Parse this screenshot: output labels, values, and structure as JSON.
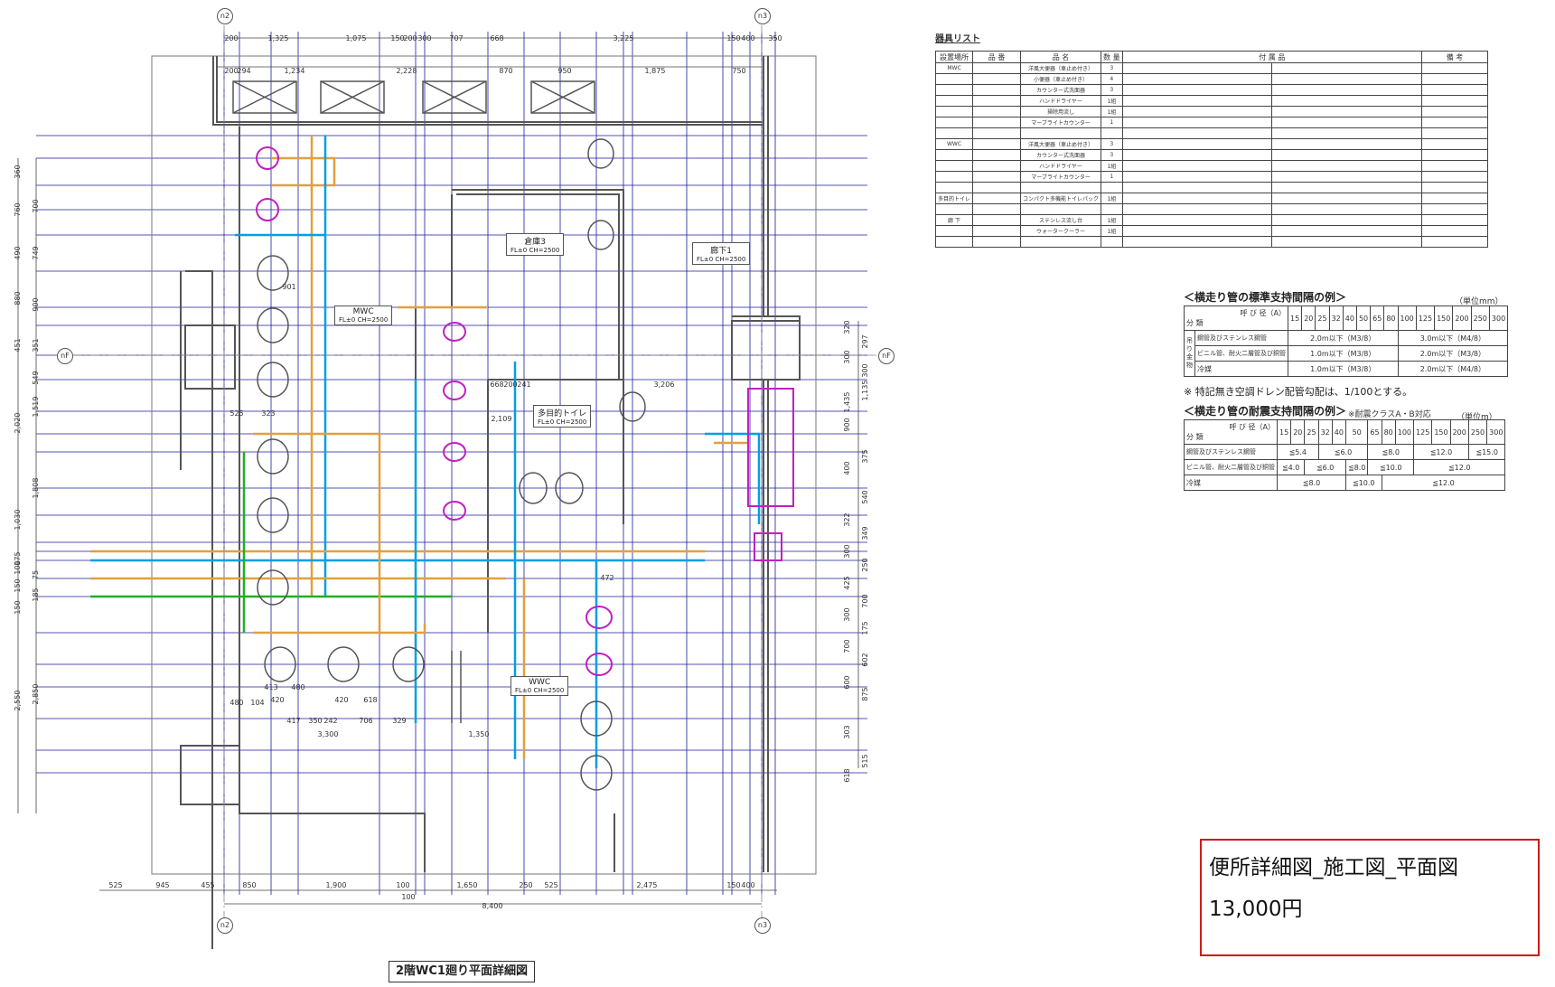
{
  "drawing": {
    "sheet_title": "2階WC1廻り平面詳細図",
    "grid_labels": {
      "n2": "n2",
      "n3": "n3",
      "nF": "nF"
    },
    "top_dims_row1": [
      "200",
      "1,325",
      "1,075",
      "150",
      "200",
      "300",
      "707",
      "668",
      "3,225",
      "150",
      "400",
      "350"
    ],
    "top_dims_row2": [
      "200",
      "294",
      "1,234",
      "2,228",
      "870",
      "950",
      "1,875",
      "750"
    ],
    "bottom_dims": [
      "525",
      "945",
      "455",
      "850",
      "1,900",
      "100",
      "1,650",
      "250",
      "525",
      "2,475",
      "150",
      "400"
    ],
    "bottom_total": "8,400",
    "bottom_sub": "100",
    "left_dims": [
      "360",
      "760",
      "700",
      "490",
      "749",
      "880",
      "900",
      "451",
      "351",
      "549",
      "1,519",
      "2,020",
      "1,808",
      "1,030",
      "175",
      "100",
      "75",
      "150",
      "185",
      "150",
      "2,850",
      "2,550"
    ],
    "right_dims": [
      "320",
      "297",
      "300",
      "300",
      "1,435",
      "1,135",
      "900",
      "375",
      "400",
      "540",
      "322",
      "349",
      "300",
      "250",
      "425",
      "700",
      "300",
      "175",
      "700",
      "602",
      "600",
      "875",
      "303",
      "515",
      "618"
    ],
    "room_labels": [
      {
        "name": "倉庫3",
        "sub": "FL±0 CH=2500"
      },
      {
        "name": "廊下1",
        "sub": "FL±0 CH=2500"
      },
      {
        "name": "MWC",
        "sub": "FL±0 CH=2500"
      },
      {
        "name": "多目的トイレ",
        "sub": "FL±0 CH=2500"
      },
      {
        "name": "WWC",
        "sub": "FL±0 CH=2500"
      }
    ],
    "inner_dims": [
      "668",
      "200",
      "241",
      "3,206",
      "901",
      "323",
      "525",
      "480",
      "104",
      "420",
      "420",
      "618",
      "417",
      "350",
      "242",
      "706",
      "329",
      "3,300",
      "1,350",
      "472",
      "2,109",
      "413",
      "480"
    ]
  },
  "equipment_list": {
    "title": "器具リスト",
    "headers": [
      "設置場所",
      "品 番",
      "品 名",
      "数 量",
      "付 属 品",
      "備 考"
    ],
    "rows": [
      [
        "MWC",
        "",
        "洋風大便器（車止め付き）",
        "3",
        "",
        "",
        ""
      ],
      [
        "",
        "",
        "小便器（車止め付き）",
        "4",
        "",
        "",
        ""
      ],
      [
        "",
        "",
        "カウンター式洗面器",
        "3",
        "",
        "",
        ""
      ],
      [
        "",
        "",
        "ハンドドライヤー",
        "1組",
        "",
        "",
        ""
      ],
      [
        "",
        "",
        "掃除用流し",
        "1組",
        "",
        "",
        ""
      ],
      [
        "",
        "",
        "マーブライトカウンター",
        "1",
        "",
        "",
        ""
      ],
      [
        "",
        "",
        "",
        "",
        "",
        "",
        ""
      ],
      [
        "WWC",
        "",
        "洋風大便器（車止め付き）",
        "3",
        "",
        "",
        ""
      ],
      [
        "",
        "",
        "カウンター式洗面器",
        "3",
        "",
        "",
        ""
      ],
      [
        "",
        "",
        "ハンドドライヤー",
        "1組",
        "",
        "",
        ""
      ],
      [
        "",
        "",
        "マーブライトカウンター",
        "1",
        "",
        "",
        ""
      ],
      [
        "",
        "",
        "",
        "",
        "",
        "",
        ""
      ],
      [
        "多目的トイレ",
        "",
        "コンパクト多機能トイレパック",
        "1組",
        "",
        "",
        ""
      ],
      [
        "",
        "",
        "",
        "",
        "",
        "",
        ""
      ],
      [
        "廊 下",
        "",
        "ステンレス流し台",
        "1組",
        "",
        "",
        ""
      ],
      [
        "",
        "",
        "ウォータークーラー",
        "1組",
        "",
        "",
        ""
      ],
      [
        "",
        "",
        "",
        "",
        "",
        "",
        ""
      ]
    ]
  },
  "support_std": {
    "title": "＜横走り管の標準支持間隔の例＞",
    "unit": "（単位mm）",
    "caliber_label": "呼 び 径（A）",
    "category_label": "分 類",
    "calibers": [
      "15",
      "20",
      "25",
      "32",
      "40",
      "50",
      "65",
      "80",
      "100",
      "125",
      "150",
      "200",
      "250",
      "300"
    ],
    "rows": [
      {
        "label": "鋼管及びステンレス鋼管",
        "left": "2.0m以下（M3/8）",
        "right": "3.0m以下（M4/8）"
      },
      {
        "label": "ビニル管、耐火二層管及び銅管",
        "left": "1.0m以下（M3/8）",
        "right": "2.0m以下（M3/8）"
      },
      {
        "label": "冷媒",
        "left": "1.0m以下（M3/8）",
        "right": "2.0m以下（M4/8）"
      }
    ],
    "side_label": "吊り金物",
    "note": "※ 特記無き空調ドレン配管勾配は、1/100とする。"
  },
  "support_seismic": {
    "title": "＜横走り管の耐震支持間隔の例＞",
    "subtitle": "※耐震クラスA・B対応",
    "unit": "（単位m）",
    "caliber_label": "呼 び 径（A）",
    "category_label": "分 類",
    "calibers": [
      "15",
      "20",
      "25",
      "32",
      "40",
      "50",
      "65",
      "80",
      "100",
      "125",
      "150",
      "200",
      "250",
      "300"
    ],
    "rows": [
      {
        "label": "鋼管及びステンレス鋼管",
        "cells": [
          "≦5.4",
          "≦6.0",
          "≦8.0",
          "≦12.0",
          "≦15.0"
        ]
      },
      {
        "label": "ビニル管、耐火二層管及び銅管",
        "cells": [
          "≦4.0",
          "≦6.0",
          "≦8.0",
          "≦10.0",
          "≦12.0"
        ]
      },
      {
        "label": "冷媒",
        "cells": [
          "≦8.0",
          "≦10.0",
          "≦12.0"
        ]
      }
    ]
  },
  "product": {
    "name": "便所詳細図_施工図_平面図",
    "price": "13,000円"
  },
  "colors": {
    "line": "#1a1a9e",
    "wall": "#555555",
    "pipe_cold": "#00a0e0",
    "pipe_hot": "#e0a040",
    "fixture": "#c020c0",
    "green": "#20b020",
    "price_border": "#d01818"
  }
}
